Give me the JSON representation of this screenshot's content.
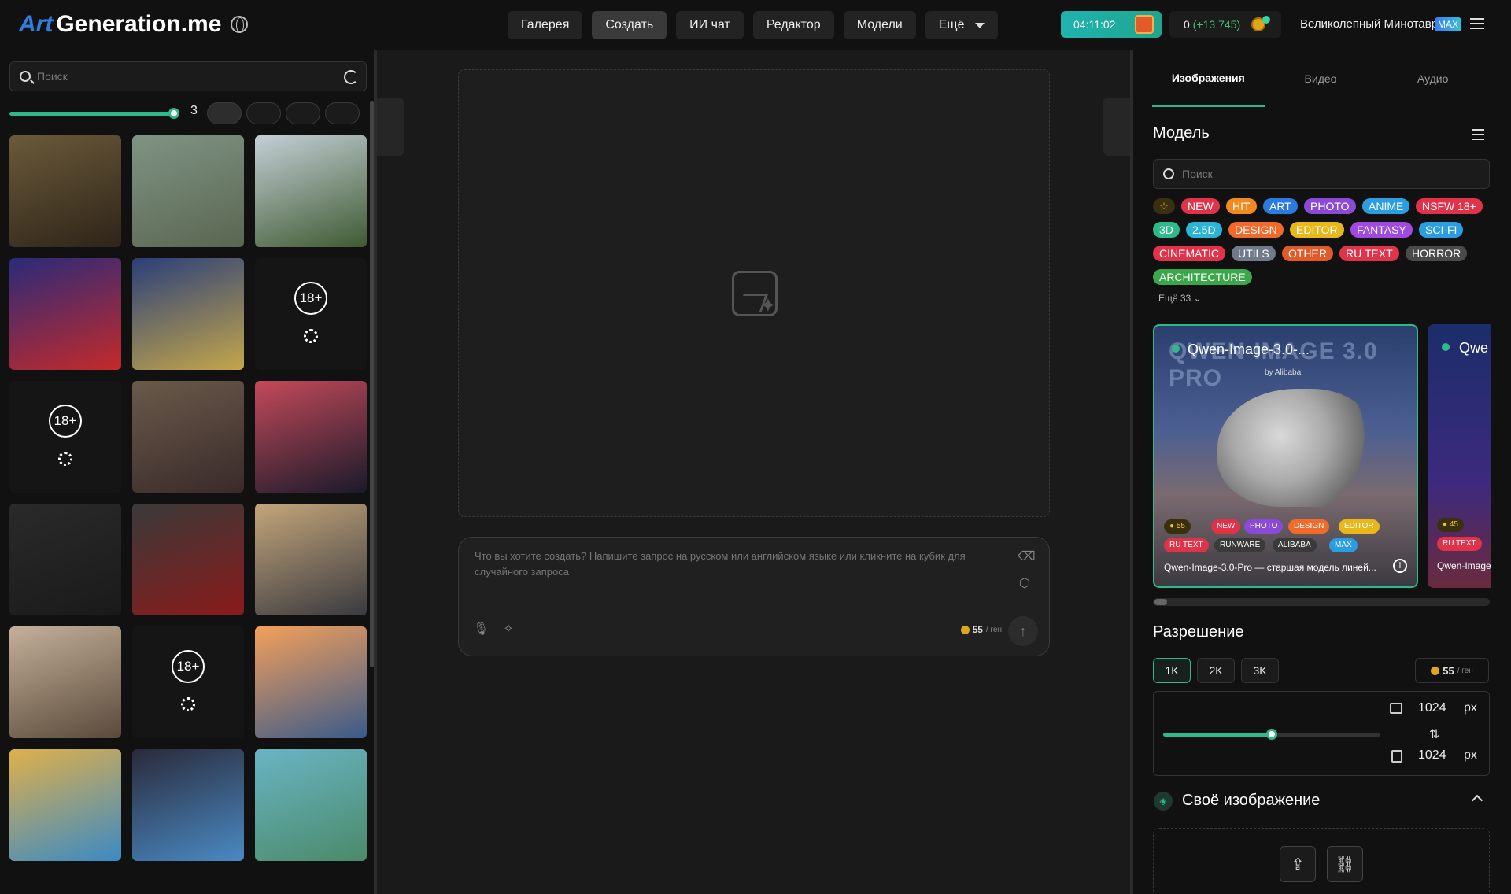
{
  "header": {
    "logo_art": "Art",
    "logo_rest": "Generation.me",
    "nav": [
      "Галерея",
      "Создать",
      "ИИ чат",
      "Редактор",
      "Модели",
      "Ещё"
    ],
    "active_nav": "Создать",
    "timer": "04:11:02",
    "balance": "0",
    "balance_bonus": "(+13 745)",
    "user_name": "Великолепный Минотавр",
    "user_badge": "MAX"
  },
  "left": {
    "search_placeholder": "Поиск",
    "columns_count": "3",
    "columns_fraction": 0.6,
    "thumbnails": [
      {
        "name": "thumb-fairy",
        "colors": [
          "#6b5a3a",
          "#2e2418"
        ]
      },
      {
        "name": "thumb-doll",
        "colors": [
          "#7f9485",
          "#5a6650"
        ]
      },
      {
        "name": "thumb-cliff",
        "colors": [
          "#c4cfd6",
          "#3f5a32"
        ]
      },
      {
        "name": "thumb-mushroom",
        "colors": [
          "#2a2a7a",
          "#c42a2a"
        ]
      },
      {
        "name": "thumb-witch",
        "colors": [
          "#2a3f7a",
          "#c4a64a"
        ]
      },
      {
        "name": "thumb-nsfw-1",
        "nsfw": true
      },
      {
        "name": "thumb-nsfw-2",
        "nsfw": true
      },
      {
        "name": "thumb-umbrella-girl",
        "colors": [
          "#6a5a4a",
          "#3a2a2a"
        ]
      },
      {
        "name": "thumb-cat-sunset",
        "colors": [
          "#c44a5a",
          "#1a1a2a"
        ]
      },
      {
        "name": "thumb-dark",
        "colors": [
          "#2a2a2a",
          "#1a1a1a"
        ]
      },
      {
        "name": "thumb-roses",
        "colors": [
          "#3a3a3a",
          "#8a1a1a"
        ]
      },
      {
        "name": "thumb-cat-window",
        "colors": [
          "#c4a67a",
          "#3a3a40"
        ]
      },
      {
        "name": "thumb-dragon-sketch",
        "colors": [
          "#c4b09a",
          "#5a4a3a"
        ]
      },
      {
        "name": "thumb-nsfw-3",
        "nsfw": true
      },
      {
        "name": "thumb-ladybug",
        "colors": [
          "#f4a05a",
          "#3a5a8a"
        ]
      },
      {
        "name": "thumb-venice",
        "colors": [
          "#e0b04a",
          "#3a8ac4"
        ]
      },
      {
        "name": "thumb-bird",
        "colors": [
          "#2a2a3a",
          "#4a8ac4"
        ]
      },
      {
        "name": "thumb-stilt-house",
        "colors": [
          "#6ab4c4",
          "#4a8a6a"
        ]
      }
    ],
    "nsfw_label": "18+"
  },
  "center": {
    "prompt_placeholder": "Что вы хотите создать? Напишите запрос на русском или английском языке или кликните на кубик для случайного запроса",
    "cost": "55",
    "cost_unit": "/ ген"
  },
  "right": {
    "tabs": [
      "Изображения",
      "Видео",
      "Аудио"
    ],
    "model_heading": "Модель",
    "search_placeholder": "Поиск",
    "tags": [
      {
        "label": "NEW",
        "color": "#e0334a"
      },
      {
        "label": "HIT",
        "color": "#f08a1e"
      },
      {
        "label": "ART",
        "color": "#2a7ae0"
      },
      {
        "label": "PHOTO",
        "color": "#8a4ad6"
      },
      {
        "label": "ANIME",
        "color": "#2a9ee0"
      },
      {
        "label": "NSFW 18+",
        "color": "#e0334a"
      },
      {
        "label": "3D",
        "color": "#2eb88c"
      },
      {
        "label": "2.5D",
        "color": "#2ab4d6"
      },
      {
        "label": "DESIGN",
        "color": "#f06a2a"
      },
      {
        "label": "EDITOR",
        "color": "#e8b81a"
      },
      {
        "label": "FANTASY",
        "color": "#a04ae0"
      },
      {
        "label": "SCI-FI",
        "color": "#2a9ee0"
      },
      {
        "label": "CINEMATIC",
        "color": "#e0334a"
      },
      {
        "label": "UTILS",
        "color": "#707a8a"
      },
      {
        "label": "OTHER",
        "color": "#e05a2a"
      },
      {
        "label": "RU TEXT",
        "color": "#e0334a"
      },
      {
        "label": "HORROR",
        "color": "#4a4a4a"
      },
      {
        "label": "ARCHITECTURE",
        "color": "#3aa84a"
      }
    ],
    "more_tags": "Ещё 33",
    "model_card": {
      "title": "Qwen-Image-3.0-...",
      "big_title": "QWEN-IMAGE 3.0 PRO",
      "by": "by Alibaba",
      "cost": "55",
      "tags": [
        "NEW",
        "PHOTO",
        "DESIGN",
        "EDITOR",
        "RU TEXT",
        "RUNWARE",
        "ALIBABA",
        "MAX"
      ],
      "description": "Qwen-Image-3.0-Pro — старшая модель линей..."
    },
    "model_card2": {
      "title": "Qwe",
      "cost": "45",
      "tag": "RU TEXT",
      "description": "Qwen-Image"
    },
    "resolution_heading": "Разрешение",
    "resolutions": [
      "1K",
      "2K",
      "3K"
    ],
    "active_resolution": "1K",
    "cost": "55",
    "cost_unit": "/ ген",
    "width": "1024",
    "height": "1024",
    "unit": "px",
    "size_fraction": 0.5,
    "own_image_heading": "Своё изображение"
  }
}
